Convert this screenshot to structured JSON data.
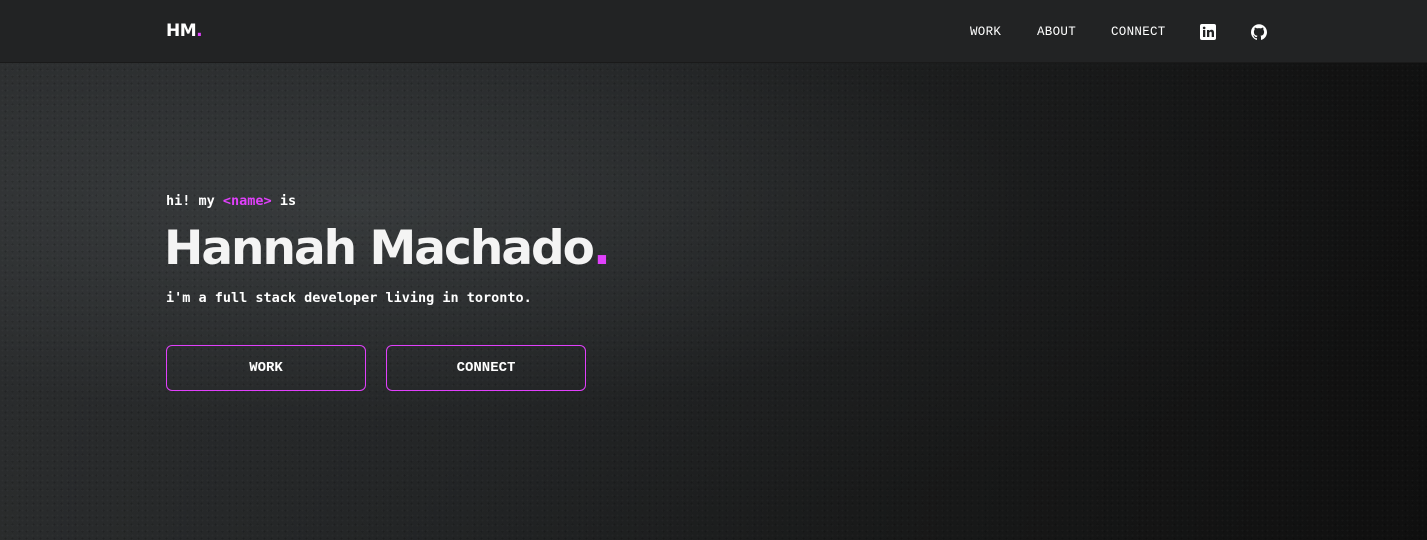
{
  "brand": {
    "logo_text": "HM",
    "logo_dot": ".",
    "accent_color": "#e040fb"
  },
  "nav": {
    "links": [
      {
        "label": "WORK"
      },
      {
        "label": "ABOUT"
      },
      {
        "label": "CONNECT"
      }
    ],
    "icons": [
      "linkedin-icon",
      "github-icon"
    ]
  },
  "hero": {
    "intro_prefix": "hi! my ",
    "intro_tag": "<name>",
    "intro_suffix": " is",
    "name": "Hannah Machado",
    "name_dot": ".",
    "tagline": "i'm a full stack developer living in toronto.",
    "buttons": [
      {
        "label": "WORK"
      },
      {
        "label": "CONNECT"
      }
    ]
  }
}
